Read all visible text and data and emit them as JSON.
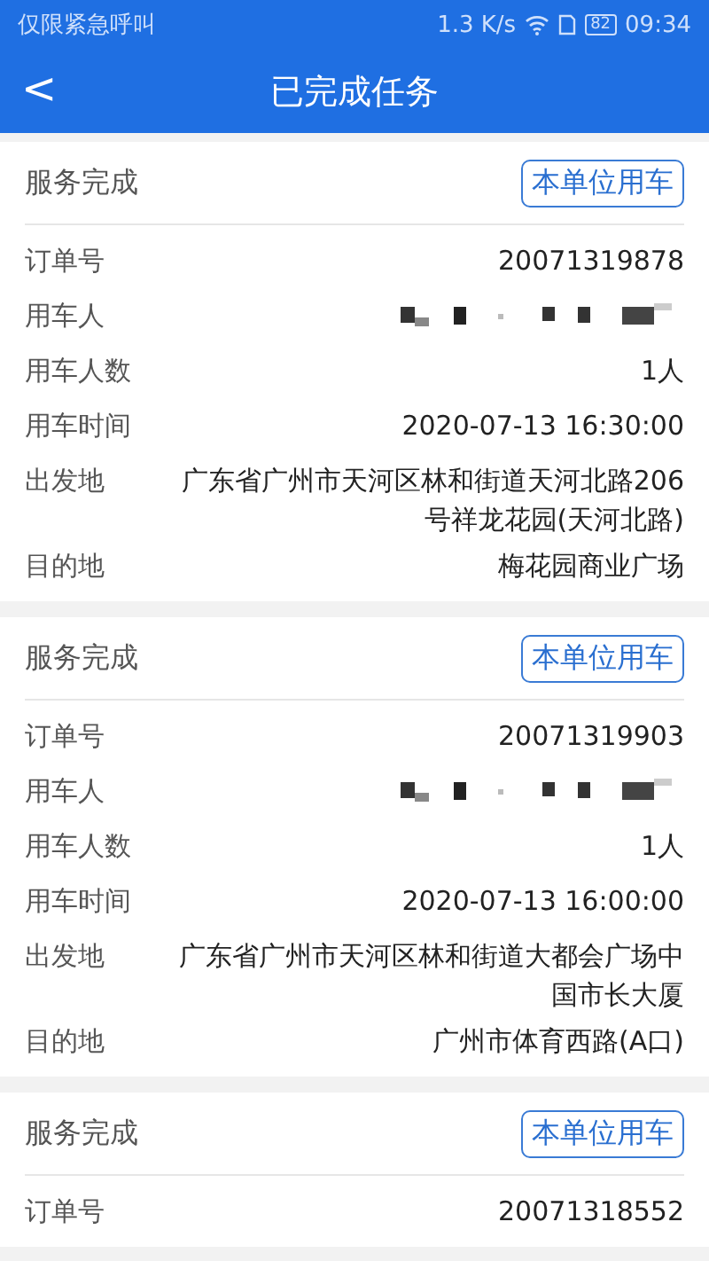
{
  "status_bar": {
    "carrier": "仅限紧急呼叫",
    "speed": "1.3 K/s",
    "battery": "82",
    "time": "09:34"
  },
  "header": {
    "back": "<",
    "title": "已完成任务"
  },
  "orders": [
    {
      "status": "服务完成",
      "tag": "本单位用车",
      "fields": [
        {
          "kind": "text",
          "label": "订单号",
          "value": "20071319878"
        },
        {
          "kind": "redacted",
          "label": "用车人"
        },
        {
          "kind": "text",
          "label": "用车人数",
          "value": "1人"
        },
        {
          "kind": "text",
          "label": "用车时间",
          "value": "2020-07-13 16:30:00"
        },
        {
          "kind": "text",
          "label": "出发地",
          "value": "广东省广州市天河区林和街道天河北路206号祥龙花园(天河北路)"
        },
        {
          "kind": "text",
          "label": "目的地",
          "value": "梅花园商业广场"
        }
      ]
    },
    {
      "status": "服务完成",
      "tag": "本单位用车",
      "fields": [
        {
          "kind": "text",
          "label": "订单号",
          "value": "20071319903"
        },
        {
          "kind": "redacted",
          "label": "用车人"
        },
        {
          "kind": "text",
          "label": "用车人数",
          "value": "1人"
        },
        {
          "kind": "text",
          "label": "用车时间",
          "value": "2020-07-13 16:00:00"
        },
        {
          "kind": "text",
          "label": "出发地",
          "value": "广东省广州市天河区林和街道大都会广场中国市长大厦"
        },
        {
          "kind": "text",
          "label": "目的地",
          "value": "广州市体育西路(A口)"
        }
      ]
    },
    {
      "status": "服务完成",
      "tag": "本单位用车",
      "fields": [
        {
          "kind": "text",
          "label": "订单号",
          "value": "20071318552"
        }
      ]
    }
  ]
}
